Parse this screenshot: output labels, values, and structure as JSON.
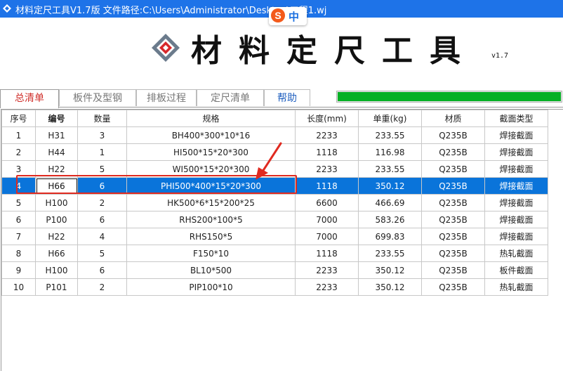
{
  "window": {
    "title": "材料定尺工具V1.7版  文件路径:C:\\Users\\Administrator\\Desktop\\工程1.wj",
    "accent": "#1e73e8"
  },
  "ime": {
    "logo": "S",
    "mode": "中"
  },
  "header": {
    "title": "材料定尺工具",
    "version": "v1.7"
  },
  "tabs": [
    {
      "label": "总清单",
      "active": true
    },
    {
      "label": "板件及型钢",
      "active": false
    },
    {
      "label": "排板过程",
      "active": false
    },
    {
      "label": "定尺清单",
      "active": false
    },
    {
      "label": "帮助",
      "active": false
    }
  ],
  "progress": {
    "value": 1.0,
    "color": "#06b025"
  },
  "table": {
    "columns": [
      "序号",
      "编号",
      "数量",
      "规格",
      "长度(mm)",
      "单重(kg)",
      "材质",
      "截面类型"
    ],
    "selected_row": 3,
    "rows": [
      [
        "1",
        "H31",
        "3",
        "BH400*300*10*16",
        "2233",
        "233.55",
        "Q235B",
        "焊接截面"
      ],
      [
        "2",
        "H44",
        "1",
        "HI500*15*20*300",
        "1118",
        "116.98",
        "Q235B",
        "焊接截面"
      ],
      [
        "3",
        "H22",
        "5",
        "WI500*15*20*300",
        "2233",
        "233.55",
        "Q235B",
        "焊接截面"
      ],
      [
        "4",
        "H66",
        "6",
        "PHI500*400*15*20*300",
        "1118",
        "350.12",
        "Q235B",
        "焊接截面"
      ],
      [
        "5",
        "H100",
        "2",
        "HK500*6*15*200*25",
        "6600",
        "466.69",
        "Q235B",
        "焊接截面"
      ],
      [
        "6",
        "P100",
        "6",
        "RHS200*100*5",
        "7000",
        "583.26",
        "Q235B",
        "焊接截面"
      ],
      [
        "7",
        "H22",
        "4",
        "RHS150*5",
        "7000",
        "699.83",
        "Q235B",
        "焊接截面"
      ],
      [
        "8",
        "H66",
        "5",
        "F150*10",
        "1118",
        "233.55",
        "Q235B",
        "热轧截面"
      ],
      [
        "9",
        "H100",
        "6",
        "BL10*500",
        "2233",
        "350.12",
        "Q235B",
        "板件截面"
      ],
      [
        "10",
        "P101",
        "2",
        "PIP100*10",
        "2233",
        "350.12",
        "Q235B",
        "热轧截面"
      ]
    ]
  },
  "colors": {
    "selection": "#0a74da",
    "annotation": "#e02a20",
    "active_tab": "#d0312d"
  }
}
